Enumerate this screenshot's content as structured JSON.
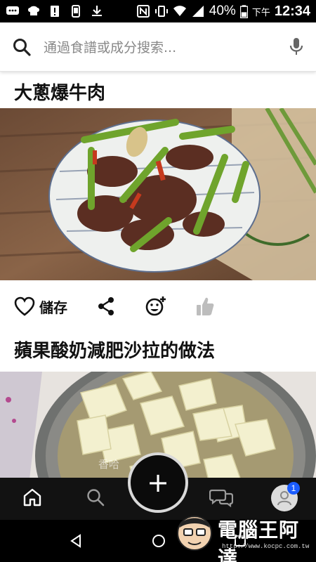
{
  "status_bar": {
    "battery_percent": "40%",
    "ampm": "下午",
    "time": "12:34"
  },
  "search": {
    "placeholder": "通過食譜或成分搜索..."
  },
  "feed": {
    "cards": [
      {
        "title": "大蔥爆牛肉",
        "save_label": "儲存"
      },
      {
        "title": "蘋果酸奶減肥沙拉的做法"
      }
    ]
  },
  "bottom_nav": {
    "notification_count": "1"
  },
  "watermark": {
    "brand": "電腦王阿達",
    "url": "http://www.kocpc.com.tw",
    "overlay": "香哈"
  },
  "colors": {
    "badge": "#1a5cff",
    "nav_bg": "#121212"
  }
}
